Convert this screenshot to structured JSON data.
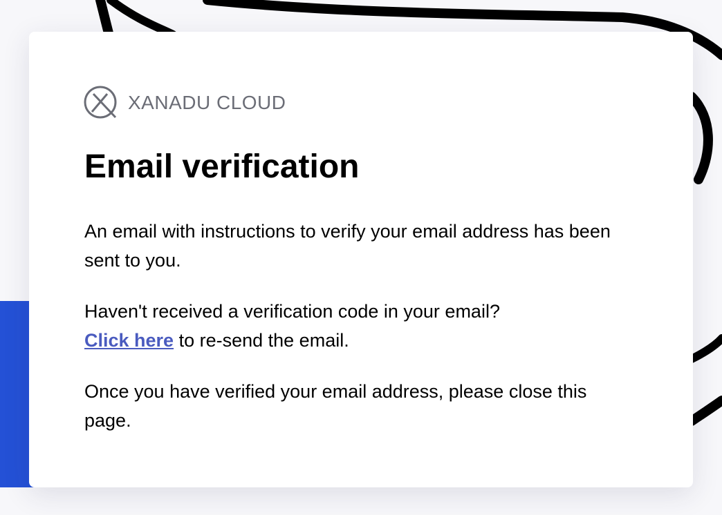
{
  "brand": {
    "name": "XANADU CLOUD",
    "logo_icon": "xanadu-x-circle-icon"
  },
  "main": {
    "title": "Email verification",
    "instructions": "An email with instructions to verify your email address has been sent to you.",
    "resend_question": "Haven't received a verification code in your email?",
    "resend_link_label": "Click here",
    "resend_suffix": " to re-send the email.",
    "close_note": "Once you have verified your email address, please close this page."
  },
  "colors": {
    "accent_blue": "#2451d6",
    "link": "#4a5bbf",
    "brand_text": "#6b6d76"
  }
}
